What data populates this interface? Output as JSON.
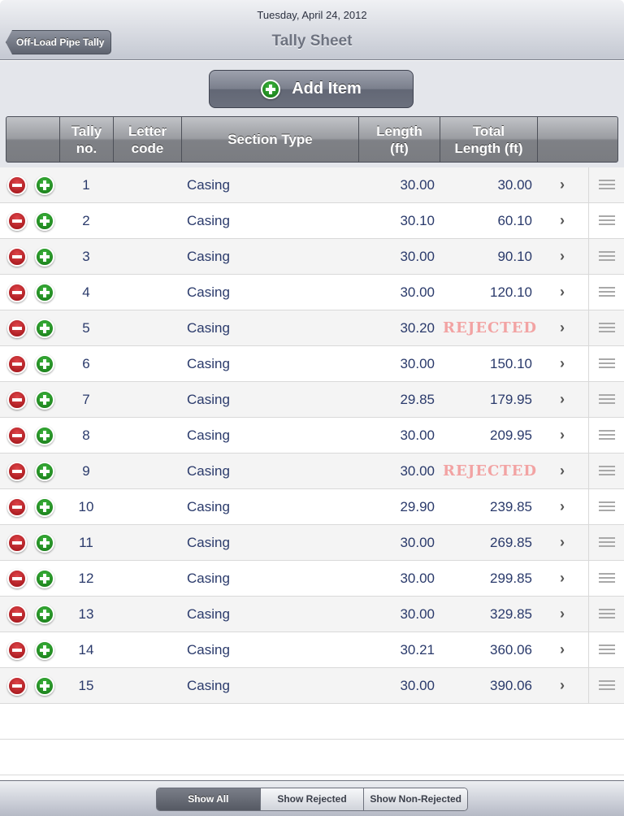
{
  "nav": {
    "date": "Tuesday, April 24, 2012",
    "title": "Tally Sheet",
    "back_label": "Off-Load Pipe Tally"
  },
  "add_button": {
    "label": "Add Item",
    "icon": "plus-circle-icon"
  },
  "columns": {
    "actions": "",
    "tally": "Tally\nno.",
    "letter": "Letter\ncode",
    "section": "Section Type",
    "length": "Length\n(ft)",
    "total": "Total\nLength (ft)",
    "extra": ""
  },
  "rows": [
    {
      "tally": "1",
      "letter": "",
      "section": "Casing",
      "length": "30.00",
      "total": "30.00",
      "rejected": false
    },
    {
      "tally": "2",
      "letter": "",
      "section": "Casing",
      "length": "30.10",
      "total": "60.10",
      "rejected": false
    },
    {
      "tally": "3",
      "letter": "",
      "section": "Casing",
      "length": "30.00",
      "total": "90.10",
      "rejected": false
    },
    {
      "tally": "4",
      "letter": "",
      "section": "Casing",
      "length": "30.00",
      "total": "120.10",
      "rejected": false
    },
    {
      "tally": "5",
      "letter": "",
      "section": "Casing",
      "length": "30.20",
      "total": "REJECTED",
      "rejected": true
    },
    {
      "tally": "6",
      "letter": "",
      "section": "Casing",
      "length": "30.00",
      "total": "150.10",
      "rejected": false
    },
    {
      "tally": "7",
      "letter": "",
      "section": "Casing",
      "length": "29.85",
      "total": "179.95",
      "rejected": false
    },
    {
      "tally": "8",
      "letter": "",
      "section": "Casing",
      "length": "30.00",
      "total": "209.95",
      "rejected": false
    },
    {
      "tally": "9",
      "letter": "",
      "section": "Casing",
      "length": "30.00",
      "total": "REJECTED",
      "rejected": true
    },
    {
      "tally": "10",
      "letter": "",
      "section": "Casing",
      "length": "29.90",
      "total": "239.85",
      "rejected": false
    },
    {
      "tally": "11",
      "letter": "",
      "section": "Casing",
      "length": "30.00",
      "total": "269.85",
      "rejected": false
    },
    {
      "tally": "12",
      "letter": "",
      "section": "Casing",
      "length": "30.00",
      "total": "299.85",
      "rejected": false
    },
    {
      "tally": "13",
      "letter": "",
      "section": "Casing",
      "length": "30.00",
      "total": "329.85",
      "rejected": false
    },
    {
      "tally": "14",
      "letter": "",
      "section": "Casing",
      "length": "30.21",
      "total": "360.06",
      "rejected": false
    },
    {
      "tally": "15",
      "letter": "",
      "section": "Casing",
      "length": "30.00",
      "total": "390.06",
      "rejected": false
    }
  ],
  "filter": {
    "options": [
      "Show All",
      "Show Rejected",
      "Show Non-Rejected"
    ],
    "selected": "Show All"
  },
  "colors": {
    "text": "#2a3a6b",
    "rejected": "#f2a3a3",
    "add_green": "#1f8f1f",
    "delete_red": "#c0181e"
  }
}
